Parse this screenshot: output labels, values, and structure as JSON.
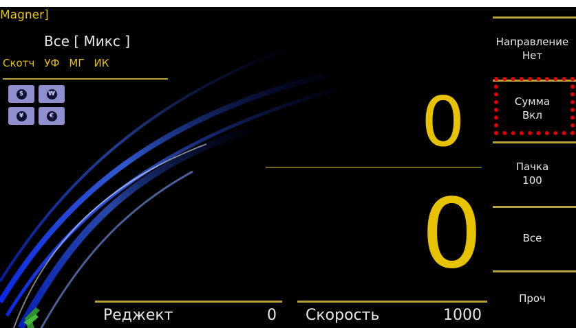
{
  "status": {
    "brand": "Magner]",
    "mode": "Все [ Микс ]",
    "sensors": [
      "Скотч",
      "УФ",
      "МГ",
      "ИК"
    ]
  },
  "currencies": [
    {
      "icon": "dollar-icon",
      "glyph": "$"
    },
    {
      "icon": "won-icon",
      "glyph": "₩"
    },
    {
      "icon": "yen-icon",
      "glyph": "¥"
    },
    {
      "icon": "euro-icon",
      "glyph": "€"
    }
  ],
  "counters": {
    "sum_value": "0",
    "count_value": "0"
  },
  "bottom": {
    "reject_label": "Реджект",
    "reject_value": "0",
    "speed_label": "Скорость",
    "speed_value": "1000"
  },
  "menu": [
    {
      "line1": "Направление",
      "line2": "Нет"
    },
    {
      "line1": "Сумма",
      "line2": "Вкл"
    },
    {
      "line1": "Пачка",
      "line2": "100"
    },
    {
      "line1": "Все",
      "line2": ""
    },
    {
      "line1": "Проч",
      "line2": ""
    }
  ],
  "colors": {
    "accent": "#e6c200",
    "background": "#000000",
    "highlight": "#e00000"
  }
}
